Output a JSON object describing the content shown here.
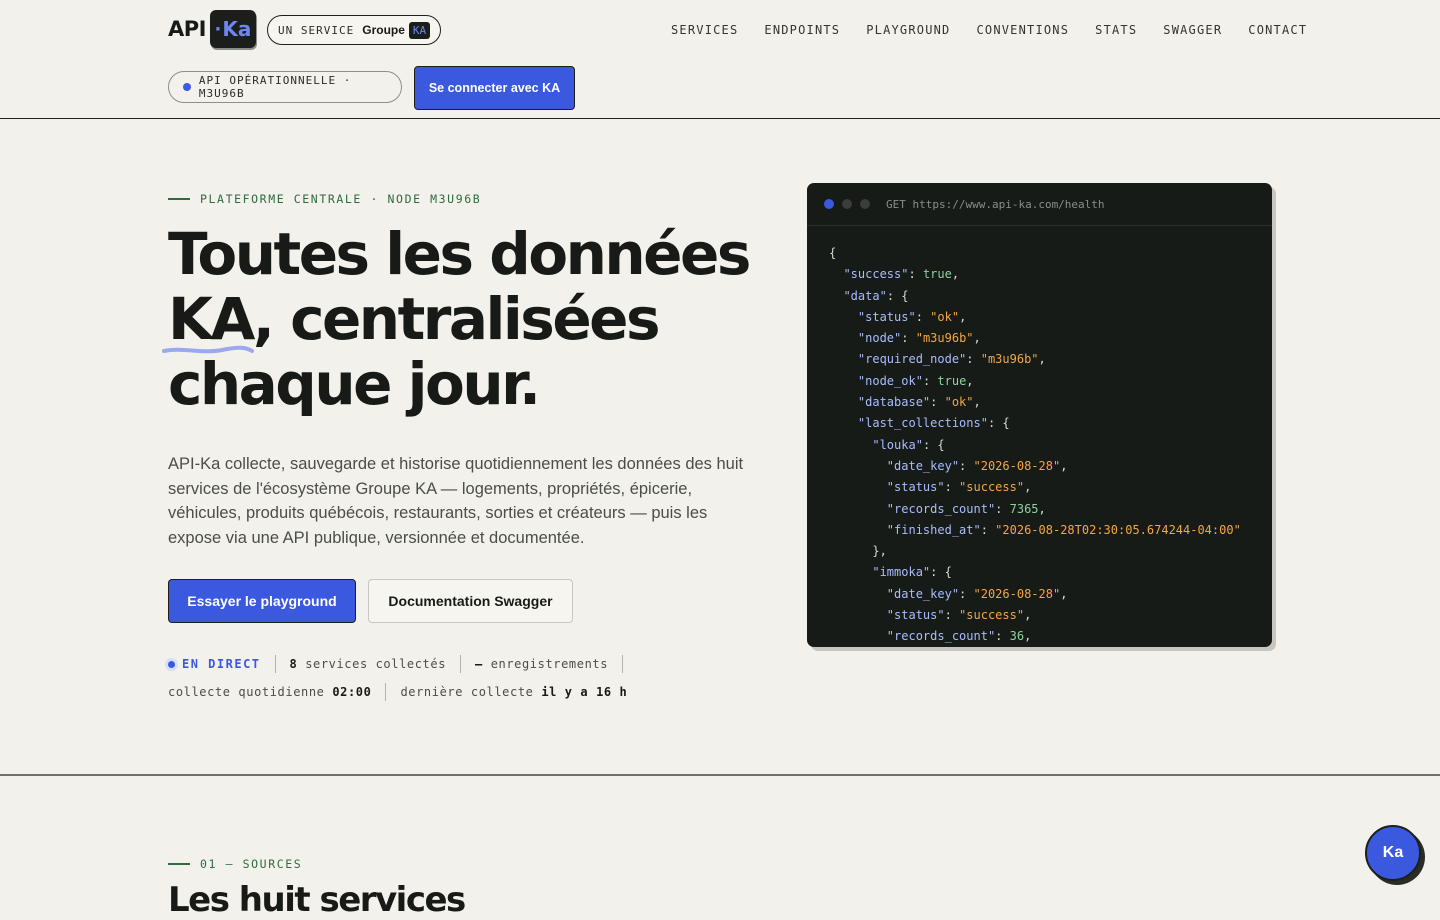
{
  "header": {
    "logo_text": "API",
    "logo_ka": "Ka",
    "service_prefix": "UN SERVICE",
    "service_brand": "Groupe",
    "service_badge": "KA",
    "nav": [
      "SERVICES",
      "ENDPOINTS",
      "PLAYGROUND",
      "CONVENTIONS",
      "STATS",
      "SWAGGER",
      "CONTACT"
    ],
    "status": "API OPÉRATIONNELLE · M3U96B",
    "connect_label": "Se connecter avec KA"
  },
  "hero": {
    "eyebrow": "PLATEFORME CENTRALE · NODE M3U96B",
    "title_line1": "Toutes les données",
    "title_ka": "KA",
    "title_line2_rest": ", centralisées",
    "title_line3": "chaque jour.",
    "lede": "API-Ka collecte, sauvegarde et historise quotidiennement les données des huit services de l'écosystème Groupe KA — logements, propriétés, épicerie, véhicules, produits québécois, restaurants, sorties et créateurs — puis les expose via une API publique, versionnée et documentée.",
    "primary_label": "Essayer le playground",
    "secondary_label": "Documentation Swagger",
    "live_label": "EN DIRECT",
    "services_count": "8",
    "services_label": "services collectés",
    "records_value": "—",
    "records_label": "enregistrements",
    "daily_label": "collecte quotidienne",
    "daily_time": "02:00",
    "last_label": "dernière collecte",
    "last_value": "il y a 16 h"
  },
  "code": {
    "request": "GET https://www.api-ka.com/health",
    "success": "true",
    "status": "\"ok\"",
    "node": "\"m3u96b\"",
    "required_node": "\"m3u96b\"",
    "node_ok": "true",
    "database": "\"ok\"",
    "louka_date_key": "\"2026-08-28\"",
    "louka_status": "\"success\"",
    "louka_records": "7365",
    "louka_finished": "\"2026-08-28T02:30:05.674244-04:00\"",
    "immoka_date_key": "\"2026-08-28\"",
    "immoka_status": "\"success\"",
    "immoka_records": "36"
  },
  "sources": {
    "eyebrow": "01 — SOURCES",
    "title": "Les huit services"
  },
  "fab_label": "Ka",
  "colors": {
    "accent": "#3b59de",
    "green": "#2e6b3e",
    "code_bg": "#171b18"
  }
}
